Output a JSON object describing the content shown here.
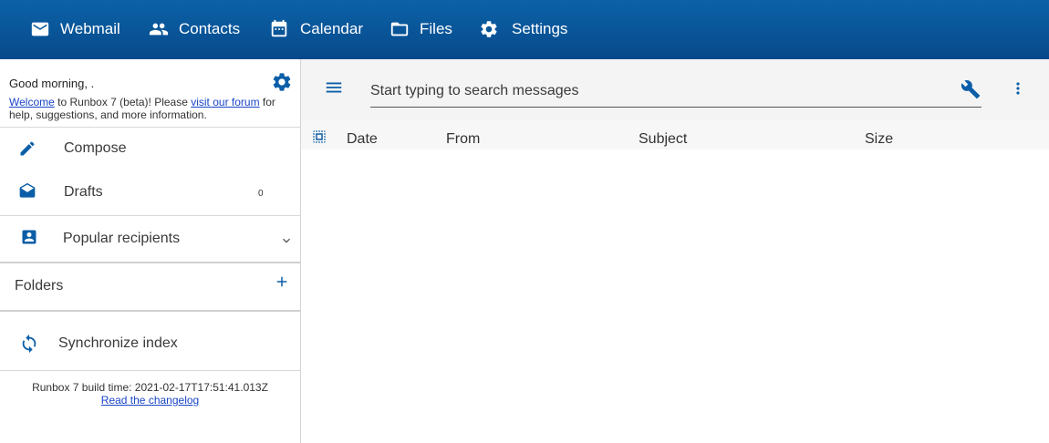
{
  "nav": {
    "items": [
      {
        "label": "Webmail",
        "icon": "mail-icon"
      },
      {
        "label": "Contacts",
        "icon": "people-icon"
      },
      {
        "label": "Calendar",
        "icon": "calendar-icon"
      },
      {
        "label": "Files",
        "icon": "folder-icon"
      },
      {
        "label": "Settings",
        "icon": "gear-icon"
      }
    ]
  },
  "sidebar": {
    "greeting": "Good morning, .",
    "welcome": {
      "link1": "Welcome",
      "text1": " to Runbox 7 (beta)! Please ",
      "link2": "visit our forum",
      "text2": " for help, suggestions, and more information."
    },
    "compose_label": "Compose",
    "drafts_label": "Drafts",
    "drafts_count": "0",
    "popular_label": "Popular recipients",
    "folders_label": "Folders",
    "sync_label": "Synchronize index",
    "build_info": "Runbox 7 build time: 2021-02-17T17:51:41.013Z",
    "changelog_link": "Read the changelog"
  },
  "main": {
    "search_placeholder": "Start typing to search messages",
    "columns": [
      "Date",
      "From",
      "Subject",
      "Size"
    ]
  },
  "colors": {
    "accent": "#0b5ea7",
    "nav_bg": "#07498a",
    "link": "#1a45c8"
  }
}
